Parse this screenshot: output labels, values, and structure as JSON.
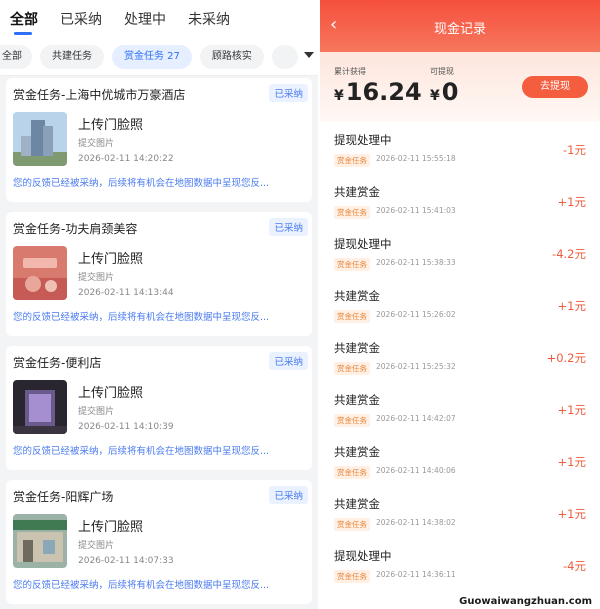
{
  "left_panel": {
    "tabs": [
      {
        "label": "全部",
        "active": true
      },
      {
        "label": "已采纳",
        "active": false
      },
      {
        "label": "处理中",
        "active": false
      },
      {
        "label": "未采纳",
        "active": false
      }
    ],
    "filters": [
      {
        "label": "全部",
        "active": false
      },
      {
        "label": "共建任务",
        "active": false
      },
      {
        "label": "赏金任务 27",
        "active": true
      },
      {
        "label": "顾路核实",
        "active": false
      },
      {
        "label": "",
        "active": false
      }
    ],
    "cards": [
      {
        "title": "赏金任务-上海中优城市万豪酒店",
        "badge": "已采纳",
        "name": "上传门脸照",
        "sub": "提交图片",
        "time": "2026-02-11 14:20:22",
        "feedback": "您的反馈已经被采纳，后续将有机会在地图数据中呈现您反..."
      },
      {
        "title": "赏金任务-功夫肩颈美容",
        "badge": "已采纳",
        "name": "上传门脸照",
        "sub": "提交图片",
        "time": "2026-02-11 14:13:44",
        "feedback": "您的反馈已经被采纳，后续将有机会在地图数据中呈现您反..."
      },
      {
        "title": "赏金任务-便利店",
        "badge": "已采纳",
        "name": "上传门脸照",
        "sub": "提交图片",
        "time": "2026-02-11 14:10:39",
        "feedback": "您的反馈已经被采纳，后续将有机会在地图数据中呈现您反..."
      },
      {
        "title": "赏金任务-阳辉广场",
        "badge": "已采纳",
        "name": "上传门脸照",
        "sub": "提交图片",
        "time": "2026-02-11 14:07:33",
        "feedback": "您的反馈已经被采纳，后续将有机会在地图数据中呈现您反..."
      }
    ]
  },
  "right_panel": {
    "back_icon": "chevron-left-icon",
    "title": "现金记录",
    "earned_label": "累计获得",
    "earned_currency": "¥",
    "earned_value": "16.24",
    "withdrawable_label": "可提现",
    "withdrawable_currency": "¥",
    "withdrawable_value": "0",
    "withdraw_button": "去提现",
    "records": [
      {
        "title": "提现处理中",
        "tag": "赏金任务",
        "time": "2026-02-11 15:55:18",
        "amount": "-1元"
      },
      {
        "title": "共建赏金",
        "tag": "赏金任务",
        "time": "2026-02-11 15:41:03",
        "amount": "+1元"
      },
      {
        "title": "提现处理中",
        "tag": "赏金任务",
        "time": "2026-02-11 15:38:33",
        "amount": "-4.2元"
      },
      {
        "title": "共建赏金",
        "tag": "赏金任务",
        "time": "2026-02-11 15:26:02",
        "amount": "+1元"
      },
      {
        "title": "共建赏金",
        "tag": "赏金任务",
        "time": "2026-02-11 15:25:32",
        "amount": "+0.2元"
      },
      {
        "title": "共建赏金",
        "tag": "赏金任务",
        "time": "2026-02-11 14:42:07",
        "amount": "+1元"
      },
      {
        "title": "共建赏金",
        "tag": "赏金任务",
        "time": "2026-02-11 14:40:06",
        "amount": "+1元"
      },
      {
        "title": "共建赏金",
        "tag": "赏金任务",
        "time": "2026-02-11 14:38:02",
        "amount": "+1元"
      },
      {
        "title": "提现处理中",
        "tag": "赏金任务",
        "time": "2026-02-11 14:36:11",
        "amount": "-4元"
      }
    ]
  },
  "watermark": "Guowaiwangzhuan.com",
  "colors": {
    "accent_blue": "#2f6ff5",
    "accent_red": "#f45d3e",
    "amount_red": "#f05a3c"
  }
}
